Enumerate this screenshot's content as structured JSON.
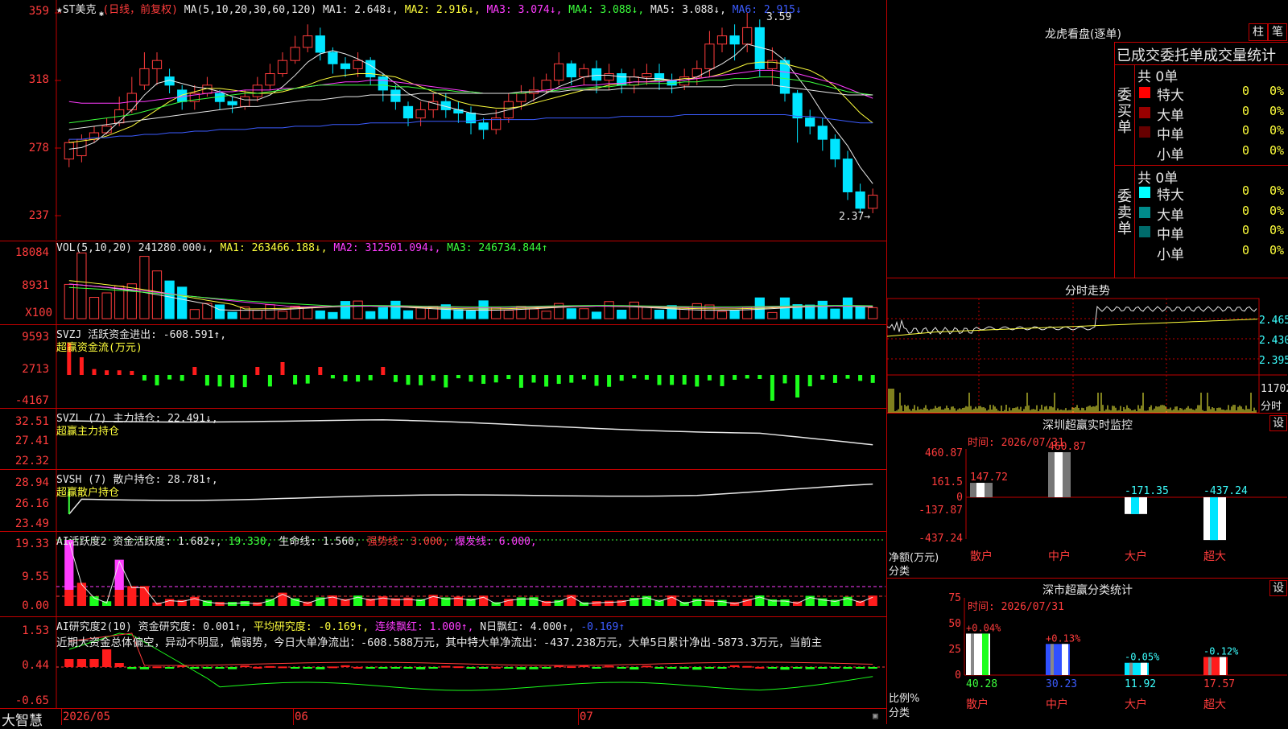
{
  "main": {
    "symbol": "★ST美克",
    "period": "(日线，前复权)",
    "ma_legend": [
      {
        "label": "MA(5,10,20,30,60,120)",
        "color": "#e8e8e8"
      },
      {
        "label": "MA1: 2.648↓,",
        "color": "#e8e8e8"
      },
      {
        "label": "MA2: 2.916↓,",
        "color": "#ffff3c"
      },
      {
        "label": "MA3: 3.074↓,",
        "color": "#ff3cff"
      },
      {
        "label": "MA4: 3.088↓,",
        "color": "#3cff3c"
      },
      {
        "label": "MA5: 3.088↓,",
        "color": "#e8e8e8"
      },
      {
        "label": "MA6: 2.915↓",
        "color": "#3c5cff"
      }
    ],
    "yticks": [
      "359",
      "318",
      "278",
      "237"
    ],
    "high_label": "3.59",
    "low_label": "2.37→",
    "candles": [
      [
        2.7,
        2.8,
        2.65,
        2.82
      ],
      [
        2.72,
        2.82,
        2.68,
        2.85
      ],
      [
        2.82,
        2.86,
        2.8,
        2.9
      ],
      [
        2.86,
        2.9,
        2.85,
        2.95
      ],
      [
        2.92,
        3.0,
        2.9,
        3.08
      ],
      [
        3.0,
        3.1,
        2.98,
        3.2
      ],
      [
        3.15,
        3.25,
        3.12,
        3.35
      ],
      [
        3.25,
        3.3,
        3.15,
        3.35
      ],
      [
        3.2,
        3.15,
        3.1,
        3.25
      ],
      [
        3.12,
        3.05,
        3.0,
        3.15
      ],
      [
        3.05,
        3.1,
        3.0,
        3.15
      ],
      [
        3.1,
        3.15,
        3.08,
        3.2
      ],
      [
        3.1,
        3.05,
        3.0,
        3.12
      ],
      [
        3.05,
        3.03,
        2.98,
        3.08
      ],
      [
        3.02,
        3.08,
        3.0,
        3.12
      ],
      [
        3.08,
        3.15,
        3.05,
        3.2
      ],
      [
        3.15,
        3.22,
        3.12,
        3.28
      ],
      [
        3.22,
        3.3,
        3.2,
        3.35
      ],
      [
        3.3,
        3.38,
        3.28,
        3.45
      ],
      [
        3.38,
        3.45,
        3.35,
        3.52
      ],
      [
        3.45,
        3.35,
        3.3,
        3.5
      ],
      [
        3.35,
        3.28,
        3.22,
        3.38
      ],
      [
        3.28,
        3.25,
        3.2,
        3.32
      ],
      [
        3.25,
        3.3,
        3.2,
        3.35
      ],
      [
        3.3,
        3.2,
        3.15,
        3.32
      ],
      [
        3.2,
        3.12,
        3.05,
        3.22
      ],
      [
        3.12,
        3.05,
        3.0,
        3.15
      ],
      [
        3.02,
        2.95,
        2.9,
        3.05
      ],
      [
        2.95,
        3.0,
        2.9,
        3.05
      ],
      [
        3.0,
        3.05,
        2.95,
        3.1
      ],
      [
        3.05,
        3.0,
        2.95,
        3.1
      ],
      [
        3.0,
        2.98,
        2.92,
        3.05
      ],
      [
        2.98,
        2.92,
        2.85,
        3.02
      ],
      [
        2.92,
        2.88,
        2.82,
        2.95
      ],
      [
        2.88,
        2.95,
        2.85,
        3.0
      ],
      [
        2.95,
        3.05,
        2.92,
        3.1
      ],
      [
        3.05,
        3.1,
        3.0,
        3.15
      ],
      [
        3.1,
        3.12,
        3.05,
        3.2
      ],
      [
        3.12,
        3.18,
        3.1,
        3.22
      ],
      [
        3.18,
        3.28,
        3.15,
        3.35
      ],
      [
        3.28,
        3.2,
        3.15,
        3.3
      ],
      [
        3.2,
        3.25,
        3.15,
        3.28
      ],
      [
        3.25,
        3.18,
        3.1,
        3.3
      ],
      [
        3.18,
        3.22,
        3.12,
        3.28
      ],
      [
        3.22,
        3.15,
        3.1,
        3.25
      ],
      [
        3.15,
        3.2,
        3.1,
        3.25
      ],
      [
        3.2,
        3.22,
        3.15,
        3.28
      ],
      [
        3.22,
        3.18,
        3.12,
        3.28
      ],
      [
        3.18,
        3.15,
        3.1,
        3.22
      ],
      [
        3.15,
        3.2,
        3.12,
        3.25
      ],
      [
        3.2,
        3.25,
        3.15,
        3.3
      ],
      [
        3.25,
        3.4,
        3.2,
        3.48
      ],
      [
        3.4,
        3.45,
        3.35,
        3.5
      ],
      [
        3.45,
        3.4,
        3.3,
        3.52
      ],
      [
        3.4,
        3.5,
        3.35,
        3.59
      ],
      [
        3.5,
        3.25,
        3.2,
        3.55
      ],
      [
        3.25,
        3.3,
        3.15,
        3.38
      ],
      [
        3.3,
        3.1,
        3.05,
        3.32
      ],
      [
        3.1,
        2.95,
        2.8,
        3.12
      ],
      [
        2.95,
        2.9,
        2.85,
        3.0
      ],
      [
        2.9,
        2.82,
        2.75,
        2.95
      ],
      [
        2.82,
        2.7,
        2.65,
        2.85
      ],
      [
        2.7,
        2.5,
        2.45,
        2.75
      ],
      [
        2.5,
        2.4,
        2.37,
        2.55
      ],
      [
        2.4,
        2.48,
        2.37,
        2.52
      ]
    ],
    "ma_lines": [
      {
        "color": "#e8e8e8",
        "values": [
          2.76,
          2.77,
          2.8,
          2.86,
          2.93,
          3.0,
          3.09,
          3.16,
          3.18,
          3.16,
          3.14,
          3.13,
          3.11,
          3.08,
          3.06,
          3.06,
          3.09,
          3.14,
          3.21,
          3.29,
          3.34,
          3.36,
          3.34,
          3.31,
          3.27,
          3.22,
          3.16,
          3.1,
          3.06,
          3.04,
          3.02,
          3.0,
          2.98,
          2.97,
          2.98,
          3.0,
          3.02,
          3.06,
          3.1,
          3.14,
          3.17,
          3.2,
          3.21,
          3.21,
          3.2,
          3.2,
          3.19,
          3.19,
          3.18,
          3.18,
          3.2,
          3.24,
          3.28,
          3.33,
          3.4,
          3.38,
          3.36,
          3.3,
          3.2,
          3.1,
          2.98,
          2.88,
          2.78,
          2.65,
          2.55
        ]
      },
      {
        "color": "#ffff3c",
        "values": [
          2.8,
          2.81,
          2.82,
          2.84,
          2.87,
          2.9,
          2.95,
          3.0,
          3.05,
          3.09,
          3.11,
          3.13,
          3.13,
          3.12,
          3.11,
          3.1,
          3.1,
          3.11,
          3.13,
          3.15,
          3.18,
          3.2,
          3.21,
          3.22,
          3.22,
          3.21,
          3.2,
          3.17,
          3.14,
          3.11,
          3.08,
          3.05,
          3.03,
          3.02,
          3.01,
          3.01,
          3.02,
          3.04,
          3.06,
          3.08,
          3.1,
          3.12,
          3.13,
          3.15,
          3.16,
          3.17,
          3.17,
          3.18,
          3.18,
          3.19,
          3.19,
          3.2,
          3.22,
          3.25,
          3.28,
          3.29,
          3.29,
          3.28,
          3.26,
          3.24,
          3.2,
          3.14,
          3.06,
          2.98,
          2.92
        ]
      },
      {
        "color": "#ff3cff",
        "values": [
          3.05,
          3.04,
          3.04,
          3.04,
          3.04,
          3.05,
          3.05,
          3.06,
          3.07,
          3.08,
          3.09,
          3.1,
          3.11,
          3.11,
          3.12,
          3.12,
          3.12,
          3.13,
          3.13,
          3.14,
          3.15,
          3.16,
          3.17,
          3.17,
          3.18,
          3.18,
          3.17,
          3.16,
          3.15,
          3.14,
          3.13,
          3.12,
          3.11,
          3.1,
          3.1,
          3.1,
          3.1,
          3.11,
          3.12,
          3.13,
          3.14,
          3.15,
          3.15,
          3.16,
          3.16,
          3.17,
          3.17,
          3.17,
          3.18,
          3.18,
          3.19,
          3.2,
          3.21,
          3.22,
          3.23,
          3.24,
          3.24,
          3.23,
          3.22,
          3.2,
          3.18,
          3.16,
          3.13,
          3.1,
          3.07
        ]
      },
      {
        "color": "#3cff3c",
        "values": [
          2.92,
          2.93,
          2.94,
          2.95,
          2.96,
          2.97,
          2.99,
          3.01,
          3.03,
          3.05,
          3.06,
          3.07,
          3.08,
          3.09,
          3.1,
          3.1,
          3.11,
          3.12,
          3.13,
          3.14,
          3.15,
          3.15,
          3.15,
          3.15,
          3.15,
          3.15,
          3.14,
          3.14,
          3.13,
          3.12,
          3.12,
          3.11,
          3.11,
          3.1,
          3.1,
          3.1,
          3.1,
          3.11,
          3.11,
          3.12,
          3.13,
          3.13,
          3.14,
          3.14,
          3.15,
          3.15,
          3.16,
          3.16,
          3.16,
          3.17,
          3.17,
          3.18,
          3.18,
          3.19,
          3.19,
          3.2,
          3.2,
          3.19,
          3.18,
          3.17,
          3.15,
          3.13,
          3.11,
          3.1,
          3.09
        ]
      },
      {
        "color": "#e8e8e8",
        "values": [
          2.88,
          2.89,
          2.9,
          2.91,
          2.92,
          2.93,
          2.94,
          2.95,
          2.96,
          2.97,
          2.98,
          2.99,
          3.0,
          3.01,
          3.02,
          3.02,
          3.03,
          3.04,
          3.05,
          3.06,
          3.06,
          3.07,
          3.08,
          3.08,
          3.09,
          3.09,
          3.09,
          3.09,
          3.1,
          3.1,
          3.1,
          3.1,
          3.1,
          3.1,
          3.1,
          3.1,
          3.11,
          3.11,
          3.11,
          3.11,
          3.12,
          3.12,
          3.12,
          3.12,
          3.13,
          3.13,
          3.13,
          3.13,
          3.13,
          3.14,
          3.14,
          3.14,
          3.14,
          3.15,
          3.15,
          3.15,
          3.15,
          3.14,
          3.13,
          3.12,
          3.11,
          3.1,
          3.09,
          3.09,
          3.09
        ]
      },
      {
        "color": "#3c5cff",
        "values": [
          2.82,
          2.82,
          2.83,
          2.83,
          2.84,
          2.84,
          2.85,
          2.85,
          2.86,
          2.86,
          2.87,
          2.87,
          2.88,
          2.88,
          2.88,
          2.89,
          2.89,
          2.89,
          2.9,
          2.9,
          2.9,
          2.91,
          2.91,
          2.91,
          2.92,
          2.92,
          2.92,
          2.92,
          2.93,
          2.93,
          2.93,
          2.93,
          2.93,
          2.94,
          2.94,
          2.94,
          2.94,
          2.94,
          2.95,
          2.95,
          2.95,
          2.95,
          2.95,
          2.95,
          2.96,
          2.96,
          2.96,
          2.96,
          2.96,
          2.97,
          2.97,
          2.97,
          2.97,
          2.97,
          2.97,
          2.97,
          2.97,
          2.97,
          2.96,
          2.96,
          2.95,
          2.94,
          2.93,
          2.92,
          2.92
        ]
      }
    ]
  },
  "vol": {
    "legend": [
      {
        "label": "VOL(5,10,20)",
        "color": "#e8e8e8"
      },
      {
        "label": "241280.000↓,",
        "color": "#e8e8e8"
      },
      {
        "label": "MA1: 263466.188↓,",
        "color": "#ffff3c"
      },
      {
        "label": "MA2: 312501.094↓,",
        "color": "#ff3cff"
      },
      {
        "label": "MA3: 246734.844↑",
        "color": "#3cff3c"
      }
    ],
    "yticks": [
      "18084",
      "8931",
      "X100"
    ]
  },
  "svzj": {
    "legend": [
      {
        "label": "SVZJ",
        "color": "#e8e8e8"
      },
      {
        "label": "活跃资金进出: -608.591↑,",
        "color": "#e8e8e8"
      }
    ],
    "subtitle": "超赢资金流(万元)",
    "yticks": [
      "9593",
      "2713",
      "-4167"
    ]
  },
  "svzl": {
    "legend": [
      {
        "label": "SVZL (7) 主力持仓: 22.491↓,",
        "color": "#e8e8e8"
      }
    ],
    "subtitle": "超赢主力持仓",
    "yticks": [
      "32.51",
      "27.41",
      "22.32"
    ]
  },
  "svsh": {
    "legend": [
      {
        "label": "SVSH (7) 散户持仓: 28.781↑,",
        "color": "#e8e8e8"
      }
    ],
    "subtitle": "超赢散户持仓",
    "yticks": [
      "28.94",
      "26.16",
      "23.49"
    ]
  },
  "ai_act": {
    "legend": [
      {
        "label": "AI活跃度2 资金活跃度: 1.682↓,",
        "color": "#e8e8e8"
      },
      {
        "label": "19.330,",
        "color": "#3cff3c"
      },
      {
        "label": "生命线: 1.560,",
        "color": "#e8e8e8"
      },
      {
        "label": "强势线: 3.000,",
        "color": "#ff3c3c"
      },
      {
        "label": "爆发线: 6.000,",
        "color": "#ff3cff"
      }
    ],
    "yticks": [
      "19.33",
      "9.55",
      "0.00"
    ]
  },
  "ai_res": {
    "legend": [
      {
        "label": "AI研究度2(10) 资金研究度: 0.001↑,",
        "color": "#e8e8e8"
      },
      {
        "label": "平均研究度: -0.169↑,",
        "color": "#ffff3c"
      },
      {
        "label": "连续飘红: 1.000↑,",
        "color": "#ff3cff"
      },
      {
        "label": "N日飘红: 4.000↑,",
        "color": "#e8e8e8"
      },
      {
        "label": "-0.169↑",
        "color": "#3c5cff"
      }
    ],
    "commentary": "近期大资金总体偏空，异动不明显，偏弱势，今日大单净流出：-608.588万元，其中特大单净流出：-437.238万元，大单5日累计净出-5873.3万元，当前主",
    "yticks": [
      "1.53",
      "0.44",
      "-0.65"
    ]
  },
  "bottom": {
    "brand": "大智慧",
    "dates": [
      "2026/05",
      "06",
      "07"
    ]
  },
  "lhb": {
    "title": "龙虎看盘(逐单)",
    "btn_zhu": "柱",
    "btn_bi": "笔",
    "subtitle": "已成交委托单成交量统计",
    "buy_label": "委买单",
    "sell_label": "委卖单",
    "buy_total": "共 0单",
    "sell_total": "共 0单",
    "buy_rows": [
      {
        "name": "特大",
        "count": "0",
        "pct": "0%",
        "color": "#ff0000"
      },
      {
        "name": "大单",
        "count": "0",
        "pct": "0%",
        "color": "#990000"
      },
      {
        "name": "中单",
        "count": "0",
        "pct": "0%",
        "color": "#660000"
      },
      {
        "name": "小单",
        "count": "0",
        "pct": "0%",
        "color": "#000000"
      }
    ],
    "sell_rows": [
      {
        "name": "特大",
        "count": "0",
        "pct": "0%",
        "color": "#00ffff"
      },
      {
        "name": "大单",
        "count": "0",
        "pct": "0%",
        "color": "#008b8b"
      },
      {
        "name": "中单",
        "count": "0",
        "pct": "0%",
        "color": "#006b6b"
      },
      {
        "name": "小单",
        "count": "0",
        "pct": "0%",
        "color": "#000000"
      }
    ]
  },
  "intraday": {
    "title": "分时走势",
    "yticks": [
      "2.465",
      "2.430",
      "2.395"
    ],
    "vol_label": "11702",
    "unit": "分时"
  },
  "sz_monitor": {
    "title": "深圳超赢实时监控",
    "set_btn": "设",
    "time": "时间: 2026/07/31",
    "ylabel": "净额(万元)",
    "xlabel": "分类",
    "yticks": [
      "460.87",
      "161.5",
      "0",
      "-137.87",
      "-437.24"
    ],
    "categories": [
      "散户",
      "中户",
      "大户",
      "超大"
    ],
    "values": [
      "147.72",
      "460.87",
      "-171.35",
      "-437.24"
    ]
  },
  "sz_class": {
    "title": "深市超赢分类统计",
    "set_btn": "设",
    "time": "时间: 2026/07/31",
    "ylabel": "比例%",
    "xlabel": "分类",
    "yticks": [
      "75",
      "50",
      "25",
      "0"
    ],
    "categories": [
      "散户",
      "中户",
      "大户",
      "超大"
    ],
    "values": [
      "40.28",
      "30.23",
      "11.92",
      "17.57"
    ],
    "changes": [
      "+0.04%",
      "+0.13%",
      "-0.05%",
      "-0.12%"
    ]
  }
}
